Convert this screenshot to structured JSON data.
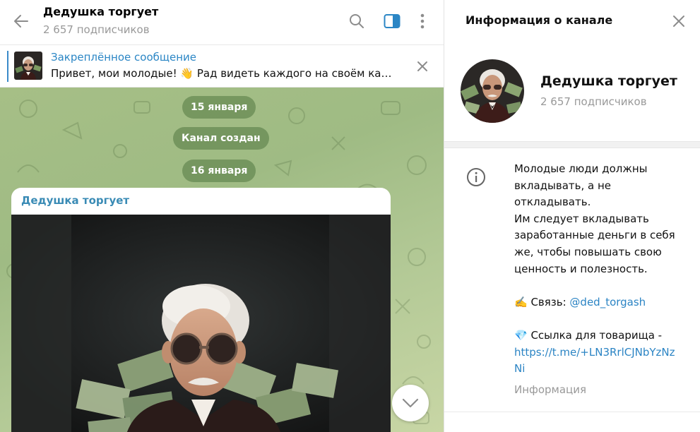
{
  "chat": {
    "title": "Дедушка торгует",
    "subscribers": "2 657 подписчиков",
    "icons": {
      "back": "back-arrow-icon",
      "search": "search-icon",
      "sidebar": "sidebar-toggle-icon",
      "menu": "more-vertical-icon"
    }
  },
  "pinned": {
    "title": "Закреплённое сообщение",
    "text": "Привет, мои молодые! 👋 Рад видеть каждого на своём кан..."
  },
  "service_messages": {
    "date1": "15 января",
    "created": "Канал создан",
    "date2": "16 января"
  },
  "post": {
    "author": "Дедушка торгует"
  },
  "info": {
    "header": "Информация о канале",
    "name": "Дедушка торгует",
    "subscribers": "2 657 подписчиков",
    "about_lines": {
      "l1": "Молодые люди должны",
      "l2": "вкладывать, а не",
      "l3": "откладывать.",
      "l4": "Им следует вкладывать",
      "l5": "заработанные деньги в себя",
      "l6": "же, чтобы повышать свою",
      "l7": "ценность и полезность.",
      "contact_prefix": "✍️ Связь: ",
      "contact_link": "@ded_torgash",
      "invite_prefix": "💎 Ссылка для товарища -",
      "invite_link_1": "https://t.me/+LN3RrlCJNbYzNz",
      "invite_link_2": "Ni"
    },
    "caption": "Информация"
  },
  "colors": {
    "accent": "#2b86c5",
    "service_bubble": "#5a8048",
    "chat_bg": "#a6bf86"
  }
}
